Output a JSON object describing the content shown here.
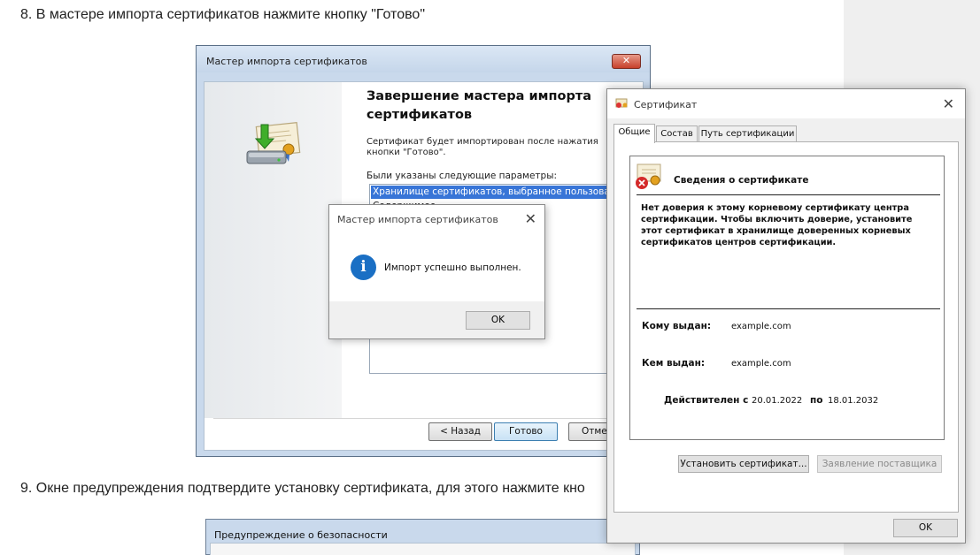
{
  "article": {
    "step8": "8. В мастере импорта сертификатов нажмите кнопку \"Готово\"",
    "step9": "9. Окне предупреждения подтвердите установку сертификата, для этого нажмите кно"
  },
  "wizard": {
    "title": "Мастер импорта сертификатов",
    "heading": "Завершение мастера импорта сертификатов",
    "description": "Сертификат будет импортирован после нажатия кнопки \"Готово\".",
    "params_label": "Были указаны следующие параметры:",
    "params": [
      "Хранилище сертификатов, выбранное пользователем",
      "Содержимое"
    ],
    "buttons": {
      "back": "< Назад",
      "finish": "Готово",
      "cancel": "Отмена"
    }
  },
  "success_dialog": {
    "title": "Мастер импорта сертификатов",
    "message": "Импорт успешно выполнен.",
    "ok": "OK"
  },
  "certificate": {
    "title": "Сертификат",
    "tabs": [
      "Общие",
      "Состав",
      "Путь сертификации"
    ],
    "info_heading": "Сведения о сертификате",
    "warning": "Нет доверия к этому корневому сертификату центра сертификации. Чтобы включить доверие, установите этот сертификат в хранилище доверенных корневых сертификатов центров сертификации.",
    "issued_to_label": "Кому выдан:",
    "issued_to": "example.com",
    "issued_by_label": "Кем выдан:",
    "issued_by": "example.com",
    "valid_label": "Действителен с",
    "valid_from": "20.01.2022",
    "valid_to_label": "по",
    "valid_to": "18.01.2032",
    "install_button": "Установить сертификат...",
    "issuer_statement_button": "Заявление поставщика",
    "ok": "OK"
  },
  "security_warning": {
    "title": "Предупреждение о безопасности"
  }
}
